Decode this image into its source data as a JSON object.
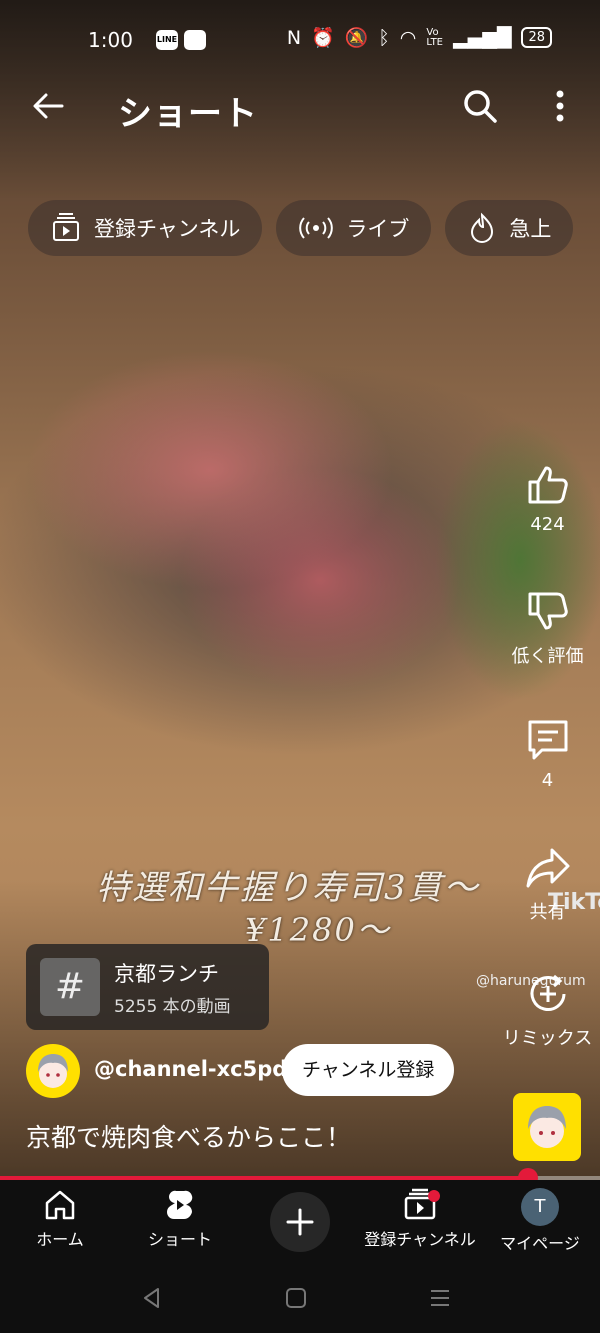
{
  "status_bar": {
    "time": "1:00",
    "apps": [
      "LINE",
      "app"
    ],
    "battery": "28"
  },
  "header": {
    "title": "ショート"
  },
  "chips": [
    {
      "label": "登録チャンネル",
      "icon": "subscriptions-icon"
    },
    {
      "label": "ライブ",
      "icon": "live-icon"
    },
    {
      "label": "急上",
      "icon": "trending-icon"
    }
  ],
  "video": {
    "caption_line1": "特選和牛握り寿司3貫〜",
    "caption_line2": "¥1280〜",
    "watermark": "TikTo",
    "watermark_handle": "@harunegurum",
    "title": "京都で焼肉食べるからここ！",
    "progress": 0.88
  },
  "actions": {
    "like_count": "424",
    "dislike_label": "低く評価",
    "comment_count": "4",
    "share_label": "共有",
    "remix_label": "リミックス"
  },
  "hashtag": {
    "symbol": "#",
    "title": "京都ランチ",
    "subtitle": "5255 本の動画"
  },
  "channel": {
    "name": "@channel-xc5pd",
    "subscribe_label": "チャンネル登録"
  },
  "bottom_nav": {
    "home": "ホーム",
    "shorts": "ショート",
    "subscriptions": "登録チャンネル",
    "mypage": "マイページ",
    "avatar_letter": "T"
  },
  "colors": {
    "accent_red": "#e31a3a",
    "nav_bg": "#0f0f0f",
    "avatar_yellow": "#ffe000"
  }
}
